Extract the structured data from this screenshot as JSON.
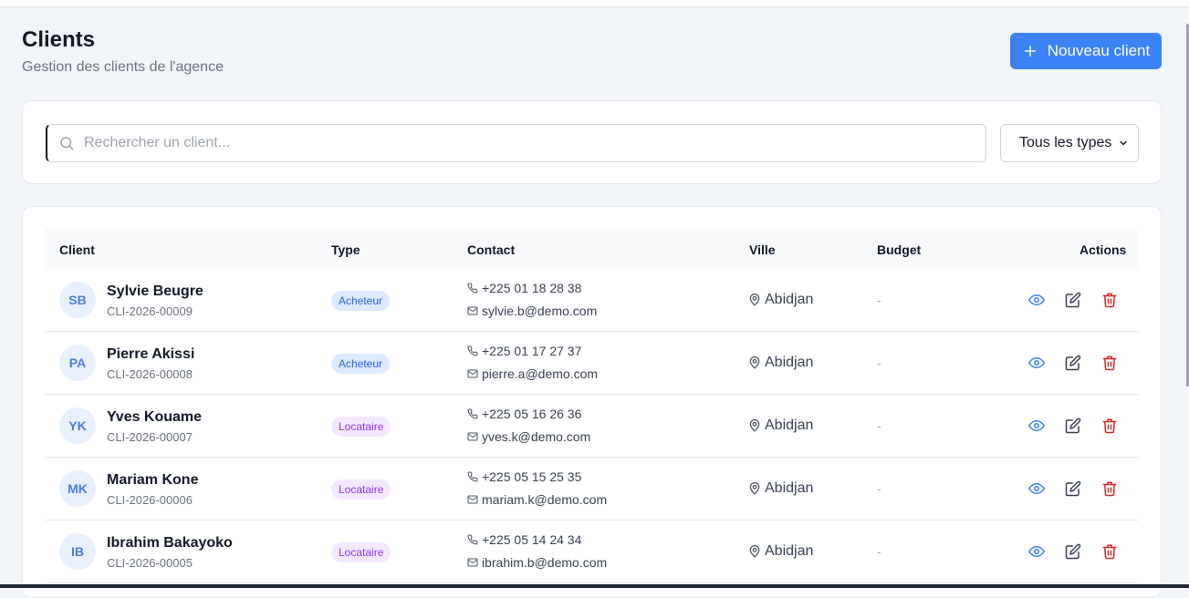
{
  "header": {
    "title": "Clients",
    "subtitle": "Gestion des clients de l'agence",
    "new_button_label": "Nouveau client"
  },
  "filters": {
    "search_placeholder": "Rechercher un client...",
    "type_select_value": "Tous les types"
  },
  "table": {
    "columns": {
      "client": "Client",
      "type": "Type",
      "contact": "Contact",
      "city": "Ville",
      "budget": "Budget",
      "actions": "Actions"
    },
    "rows": [
      {
        "initials": "SB",
        "name": "Sylvie Beugre",
        "code": "CLI-2026-00009",
        "type": "Acheteur",
        "type_kind": "buyer",
        "phone": "+225 01 18 28 38",
        "email": "sylvie.b@demo.com",
        "city": "Abidjan",
        "budget": "-"
      },
      {
        "initials": "PA",
        "name": "Pierre Akissi",
        "code": "CLI-2026-00008",
        "type": "Acheteur",
        "type_kind": "buyer",
        "phone": "+225 01 17 27 37",
        "email": "pierre.a@demo.com",
        "city": "Abidjan",
        "budget": "-"
      },
      {
        "initials": "YK",
        "name": "Yves Kouame",
        "code": "CLI-2026-00007",
        "type": "Locataire",
        "type_kind": "renter",
        "phone": "+225 05 16 26 36",
        "email": "yves.k@demo.com",
        "city": "Abidjan",
        "budget": "-"
      },
      {
        "initials": "MK",
        "name": "Mariam Kone",
        "code": "CLI-2026-00006",
        "type": "Locataire",
        "type_kind": "renter",
        "phone": "+225 05 15 25 35",
        "email": "mariam.k@demo.com",
        "city": "Abidjan",
        "budget": "-"
      },
      {
        "initials": "IB",
        "name": "Ibrahim Bakayoko",
        "code": "CLI-2026-00005",
        "type": "Locataire",
        "type_kind": "renter",
        "phone": "+225 05 14 24 34",
        "email": "ibrahim.b@demo.com",
        "city": "Abidjan",
        "budget": "-"
      }
    ]
  },
  "colors": {
    "primary": "#3b82f6",
    "view_icon": "#3b82f6",
    "edit_icon": "#374151",
    "delete_icon": "#dc2626",
    "buyer_badge_bg": "#dbeafe",
    "renter_badge_bg": "#f3e8ff"
  },
  "icons": {
    "new_button": "plus-icon",
    "search": "search-icon",
    "phone": "phone-icon",
    "email": "mail-icon",
    "city": "map-pin-icon",
    "view": "eye-icon",
    "edit": "edit-icon",
    "delete": "trash-icon"
  }
}
